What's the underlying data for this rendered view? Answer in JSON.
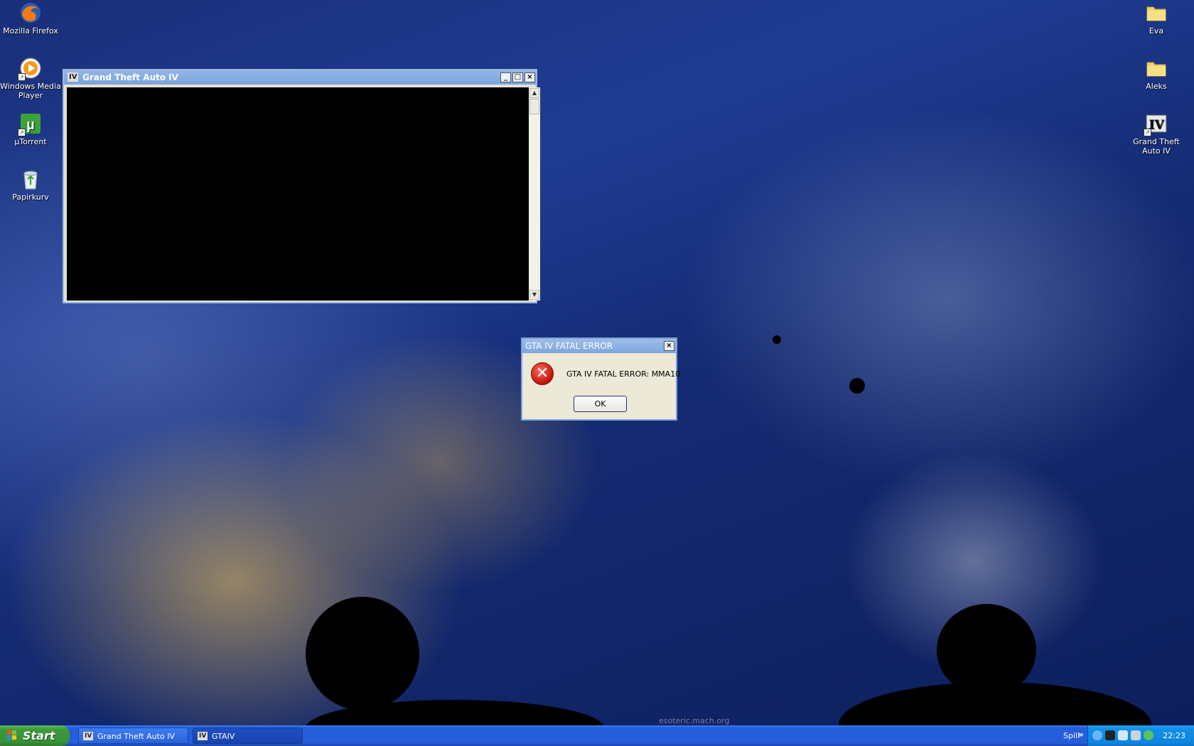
{
  "desktop": {
    "left_icons": [
      {
        "label": "Mozilla Firefox",
        "icon": "firefox-icon"
      },
      {
        "label": "Windows Media Player",
        "icon": "media-player-icon"
      },
      {
        "label": "µTorrent",
        "icon": "utorrent-icon"
      },
      {
        "label": "Papirkurv",
        "icon": "recycle-bin-icon"
      }
    ],
    "right_icons": [
      {
        "label": "Eva",
        "icon": "folder-icon"
      },
      {
        "label": "Aleks",
        "icon": "folder-icon"
      },
      {
        "label": "Grand Theft Auto IV",
        "icon": "gta-iv-icon"
      }
    ],
    "watermark": "esoteric.mach.org"
  },
  "gta_window": {
    "title": "Grand Theft Auto IV",
    "logo": "IV",
    "minimize": "_",
    "maximize": "□",
    "close": "×"
  },
  "error_dialog": {
    "title": "GTA IV FATAL ERROR",
    "message": "GTA IV FATAL ERROR: MMA10",
    "ok_label": "OK",
    "close": "×"
  },
  "taskbar": {
    "start_label": "Start",
    "tasks": [
      {
        "label": "Grand Theft Auto IV",
        "logo": "IV",
        "active": false
      },
      {
        "label": "GTAIV",
        "logo": "IV",
        "active": true
      }
    ],
    "toolbar_label": "Spill",
    "clock": "22:23"
  },
  "colors": {
    "xp_title_blue": "#7aa4db",
    "taskbar_blue": "#245edb",
    "start_green": "#3a913a",
    "tray_blue": "#0f86e0",
    "error_red": "#c0120a"
  }
}
